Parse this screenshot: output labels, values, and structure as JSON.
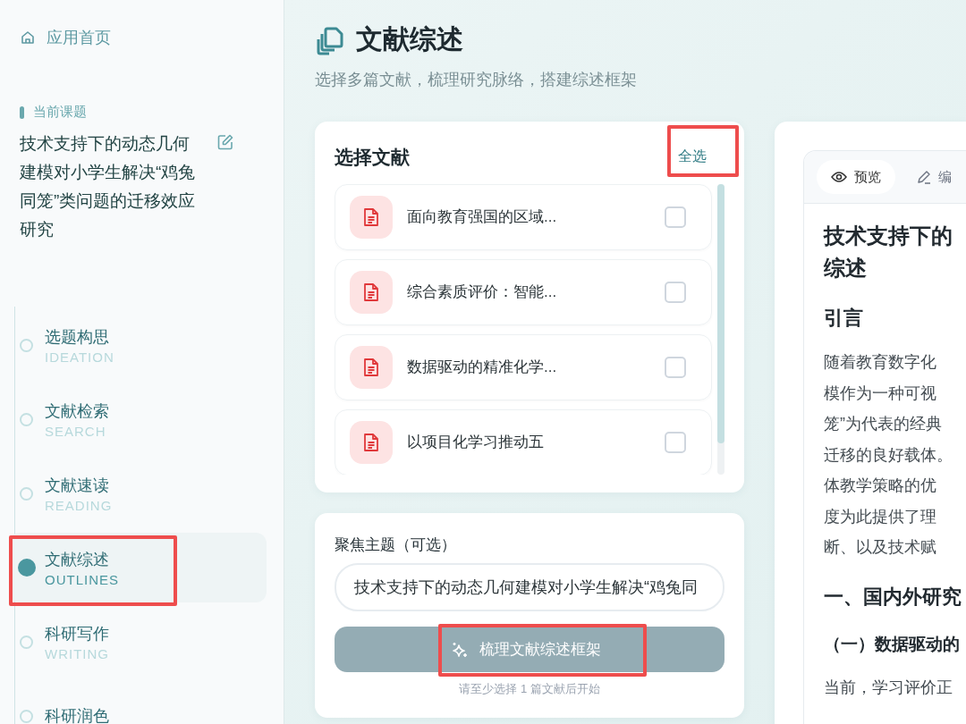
{
  "sidebar": {
    "home": {
      "label": "应用首页"
    },
    "topic": {
      "caption": "当前课题",
      "title": "技术支持下的动态几何建模对小学生解决“鸡兔同笼”类问题的迁移效应研究"
    },
    "steps": [
      {
        "label": "选题构思",
        "sub": "IDEATION",
        "selected": false,
        "highlighted": false
      },
      {
        "label": "文献检索",
        "sub": "SEARCH",
        "selected": false,
        "highlighted": false
      },
      {
        "label": "文献速读",
        "sub": "READING",
        "selected": false,
        "highlighted": false
      },
      {
        "label": "文献综述",
        "sub": "OUTLINES",
        "selected": true,
        "highlighted": true
      },
      {
        "label": "科研写作",
        "sub": "WRITING",
        "selected": false,
        "highlighted": false
      },
      {
        "label": "科研润色",
        "selected": false,
        "highlighted": false
      }
    ]
  },
  "header": {
    "title": "文献综述",
    "subtitle": "选择多篇文献，梳理研究脉络，搭建综述框架"
  },
  "select_panel": {
    "title": "选择文献",
    "select_all": {
      "label": "全选",
      "highlighted": true
    },
    "documents": [
      {
        "title": "面向教育强国的区域...",
        "checked": false
      },
      {
        "title": "综合素质评价：智能...",
        "checked": false
      },
      {
        "title": "数据驱动的精准化学...",
        "checked": false
      },
      {
        "title": "以项目化学习推动五",
        "checked": false
      }
    ]
  },
  "focus_panel": {
    "label": "聚焦主题（可选）",
    "value": "技术支持下的动态几何建模对小学生解决“鸡兔同",
    "button": {
      "label": "梳理文献综述框架",
      "disabled": true,
      "highlighted": true
    },
    "hint": "请至少选择 1 篇文献后开始"
  },
  "preview_panel": {
    "tabs": [
      {
        "label": "预览",
        "selected": true
      },
      {
        "label": "编",
        "selected": false
      }
    ],
    "title_lines": [
      "技术支持下的",
      "综述"
    ],
    "blocks": [
      {
        "kind": "h2",
        "text": "引言"
      },
      {
        "kind": "para",
        "lines": [
          "随着教育数字化",
          "模作为一种可视",
          "笼”为代表的经典",
          "迁移的良好载体。",
          "体教学策略的优",
          "度为此提供了理",
          "断、以及技术赋"
        ]
      },
      {
        "kind": "h2",
        "text": "一、国内外研究"
      },
      {
        "kind": "h3",
        "text": "（一）数据驱动的"
      },
      {
        "kind": "para",
        "lines": [
          "当前，学习评价正"
        ]
      }
    ]
  }
}
